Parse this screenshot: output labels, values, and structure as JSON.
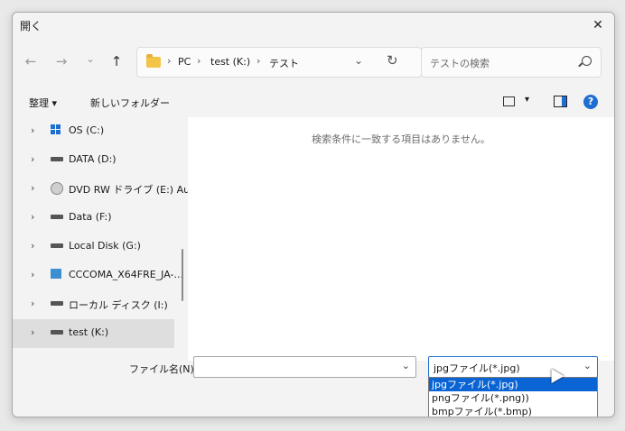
{
  "window": {
    "title": "開く",
    "close": "✕"
  },
  "nav": {
    "back": "←",
    "forward": "→",
    "recent": "⌄",
    "up": "↑"
  },
  "breadcrumb": {
    "items": [
      "PC",
      "test (K:)",
      "テスト"
    ],
    "sep": "›"
  },
  "address_dropdown": "⌄",
  "refresh": "↻",
  "search": {
    "placeholder": "テストの検索"
  },
  "toolbar": {
    "organize": "整理 ▾",
    "new_folder": "新しいフォルダー",
    "view_dropdown": "▾",
    "help": "?"
  },
  "navpane": {
    "items": [
      {
        "label": "OS (C:)",
        "icon": "windows-drive-icon",
        "selected": false
      },
      {
        "label": "DATA (D:)",
        "icon": "drive-icon",
        "selected": false
      },
      {
        "label": "DVD RW ドライブ (E:) Au",
        "icon": "dvd-icon",
        "selected": false
      },
      {
        "label": "Data (F:)",
        "icon": "drive-icon",
        "selected": false
      },
      {
        "label": "Local Disk (G:)",
        "icon": "drive-icon",
        "selected": false
      },
      {
        "label": "CCCOMA_X64FRE_JA-...",
        "icon": "iso-drive-icon",
        "selected": false
      },
      {
        "label": "ローカル ディスク (I:)",
        "icon": "drive-icon",
        "selected": false
      },
      {
        "label": "test (K:)",
        "icon": "drive-icon",
        "selected": true
      }
    ],
    "expander": "›"
  },
  "content": {
    "empty_message": "検索条件に一致する項目はありません。"
  },
  "footer": {
    "filename_label": "ファイル名(N):",
    "filename_value": "",
    "filetype_value": "jpgファイル(*.jpg)",
    "dropdown_arrow": "⌄",
    "filetype_options": [
      "jpgファイル(*.jpg)",
      "pngファイル(*.png))",
      "bmpファイル(*.bmp)"
    ]
  },
  "colors": {
    "accent": "#1f6fd1",
    "selection": "#0a64d3",
    "window_bg": "#f3f3f3"
  }
}
